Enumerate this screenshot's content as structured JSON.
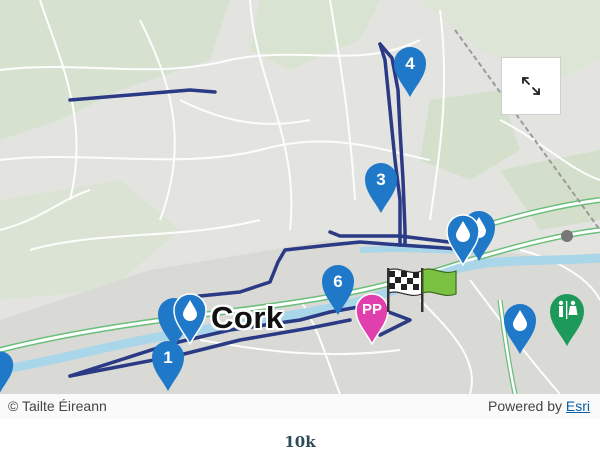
{
  "map": {
    "city_label": "Cork",
    "attribution": "© Tailte Éireann",
    "powered_by_prefix": "Powered by ",
    "powered_by_link": "Esri",
    "expand_icon": "expand-arrows-icon",
    "route_color": "#2b3a85",
    "marker_color": "#1f78c8",
    "pp_color": "#e23fae",
    "toilet_color": "#1d9a5a",
    "markers": [
      {
        "label": "4",
        "type": "km"
      },
      {
        "label": "3",
        "type": "km"
      },
      {
        "label": "6",
        "type": "km"
      },
      {
        "label": "1",
        "type": "km"
      },
      {
        "label": "PP",
        "type": "photo-point"
      }
    ],
    "icons": [
      "water-station-icon",
      "checkered-flag-icon",
      "green-flag-icon",
      "toilet-icon"
    ]
  },
  "footer": {
    "label": "10k"
  }
}
